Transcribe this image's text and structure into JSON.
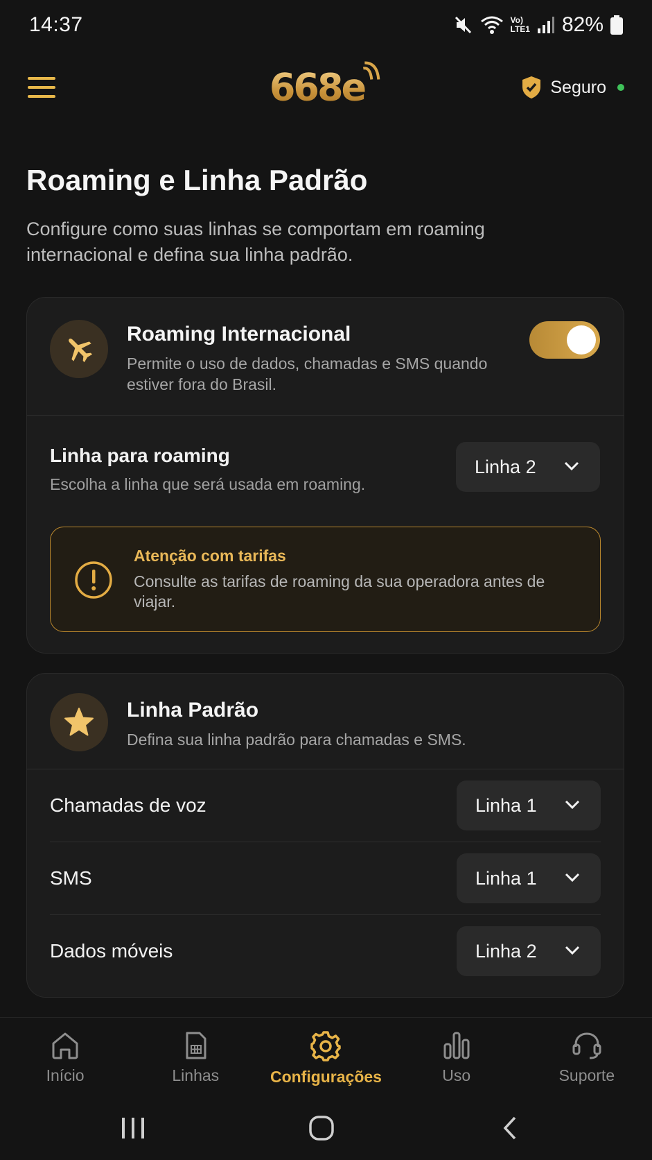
{
  "status_bar": {
    "time": "14:37",
    "battery": "82%",
    "network_label_top": "Vo)",
    "network_label_bottom": "LTE1"
  },
  "header": {
    "logo": "668e",
    "secure_label": "Seguro"
  },
  "page": {
    "title": "Roaming e Linha Padrão",
    "subtitle": "Configure como suas linhas se comportam em roaming internacional e defina sua linha padrão."
  },
  "roaming_card": {
    "title": "Roaming Internacional",
    "description": "Permite o uso de dados, chamadas e SMS quando estiver fora do Brasil.",
    "toggle_on": true,
    "line_label": "Linha para roaming",
    "line_description": "Escolha a linha que será usada em roaming.",
    "line_value": "Linha 2",
    "warning_title": "Atenção com tarifas",
    "warning_text": "Consulte as tarifas de roaming da sua operadora antes de viajar."
  },
  "default_card": {
    "title": "Linha Padrão",
    "description": "Defina sua linha padrão para chamadas e SMS.",
    "rows": [
      {
        "label": "Chamadas de voz",
        "value": "Linha 1"
      },
      {
        "label": "SMS",
        "value": "Linha 1"
      },
      {
        "label": "Dados móveis",
        "value": "Linha 2"
      }
    ]
  },
  "bottom_nav": [
    {
      "label": "Início",
      "icon": "home-icon"
    },
    {
      "label": "Linhas",
      "icon": "sim-card-icon"
    },
    {
      "label": "Configurações",
      "icon": "gear-icon",
      "active": true
    },
    {
      "label": "Uso",
      "icon": "bar-chart-icon"
    },
    {
      "label": "Suporte",
      "icon": "headset-icon"
    }
  ],
  "colors": {
    "accent": "#e8b448",
    "background": "#141414",
    "card": "#1c1c1c",
    "online": "#3fc25a"
  }
}
